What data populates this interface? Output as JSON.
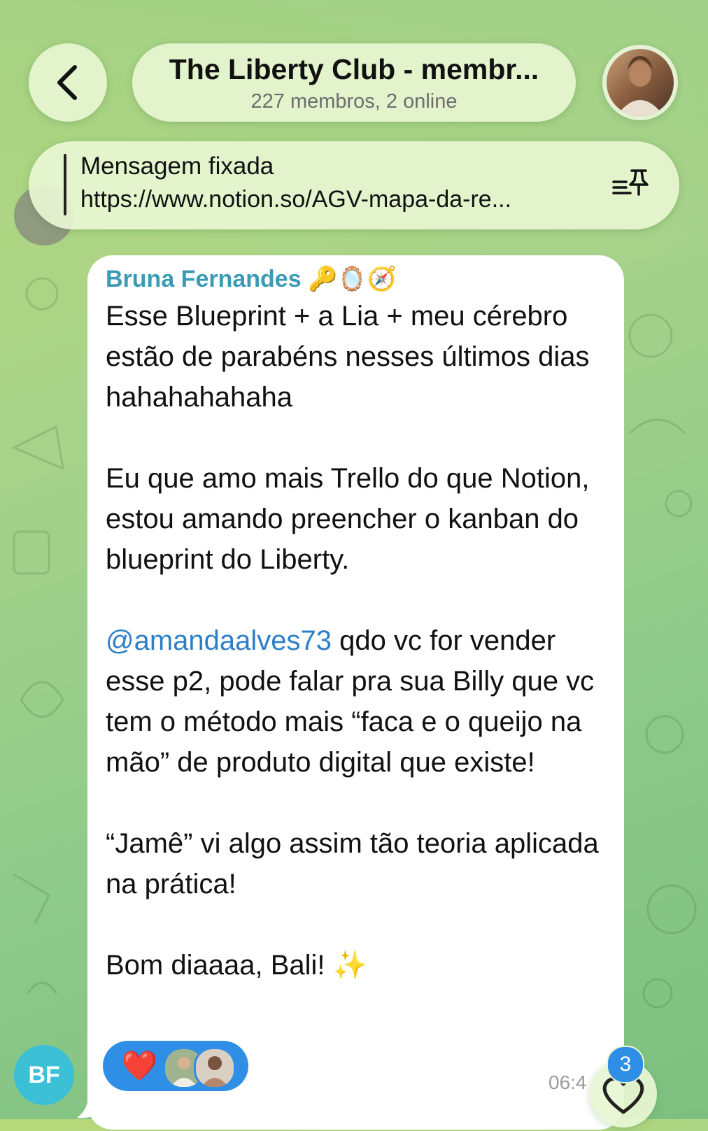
{
  "header": {
    "title": "The Liberty Club - membr...",
    "subtitle": "227 membros, 2 online"
  },
  "pinned": {
    "label": "Mensagem fixada",
    "link": "https://www.notion.so/AGV-mapa-da-re..."
  },
  "message": {
    "sender": "Bruna Fernandes",
    "sender_emojis": "🔑🪞🧭",
    "paragraphs": [
      "Esse Blueprint + a Lia + meu cérebro estão de parabéns nesses últimos dias hahahahahaha",
      "Eu que amo mais Trello do que Notion, estou amando preencher o kanban do blueprint do Liberty.",
      {
        "mention": "@amandaalves73",
        "text": " qdo vc for vender esse p2, pode falar pra sua Billy que vc tem o método mais “faca e o queijo na mão” de produto digital que existe!"
      },
      "“Jamê” vi algo assim tão teoria aplicada na prática!",
      "Bom diaaaa, Bali! ✨"
    ],
    "time": "06:4",
    "reaction_emoji": "❤️"
  },
  "sender_avatar_initials": "BF",
  "unread_reactions_count": "3",
  "colors": {
    "accent": "#2f8ee6",
    "sender_name": "#3b9bb5",
    "mention": "#2d7fc8",
    "avatar_bf": "#3cc0d6"
  }
}
